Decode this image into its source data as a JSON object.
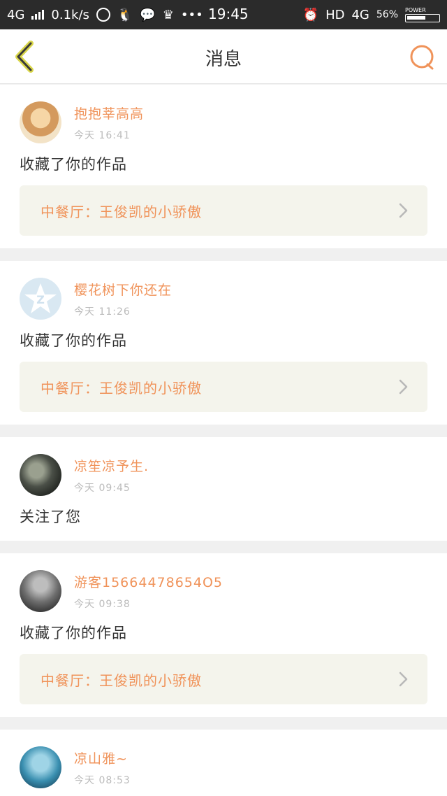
{
  "status_bar": {
    "network_left": "4G",
    "speed": "0.1k/s",
    "time": "19:45",
    "hd": "HD",
    "network_right": "4G",
    "battery_percent": "56%",
    "power_label": "POWER",
    "battery_level": 0.56
  },
  "header": {
    "title": "消息",
    "back_icon": "chevron-left-icon",
    "search_icon": "search-icon",
    "accent_color": "#f0935a"
  },
  "messages": [
    {
      "username": "抱抱莘高高",
      "time": "今天 16:41",
      "action": "收藏了你的作品",
      "work_title": "中餐厅：王俊凯的小骄傲"
    },
    {
      "username": "樱花树下你还在",
      "time": "今天 11:26",
      "action": "收藏了你的作品",
      "work_title": "中餐厅：王俊凯的小骄傲"
    },
    {
      "username": "凉笙凉予生.",
      "time": "今天 09:45",
      "action": "关注了您",
      "work_title": ""
    },
    {
      "username": "游客15664478654O5",
      "time": "今天 09:38",
      "action": "收藏了你的作品",
      "work_title": "中餐厅：王俊凯的小骄傲"
    },
    {
      "username": "凉山雅~",
      "time": "今天 08:53",
      "action": "",
      "work_title": ""
    }
  ]
}
